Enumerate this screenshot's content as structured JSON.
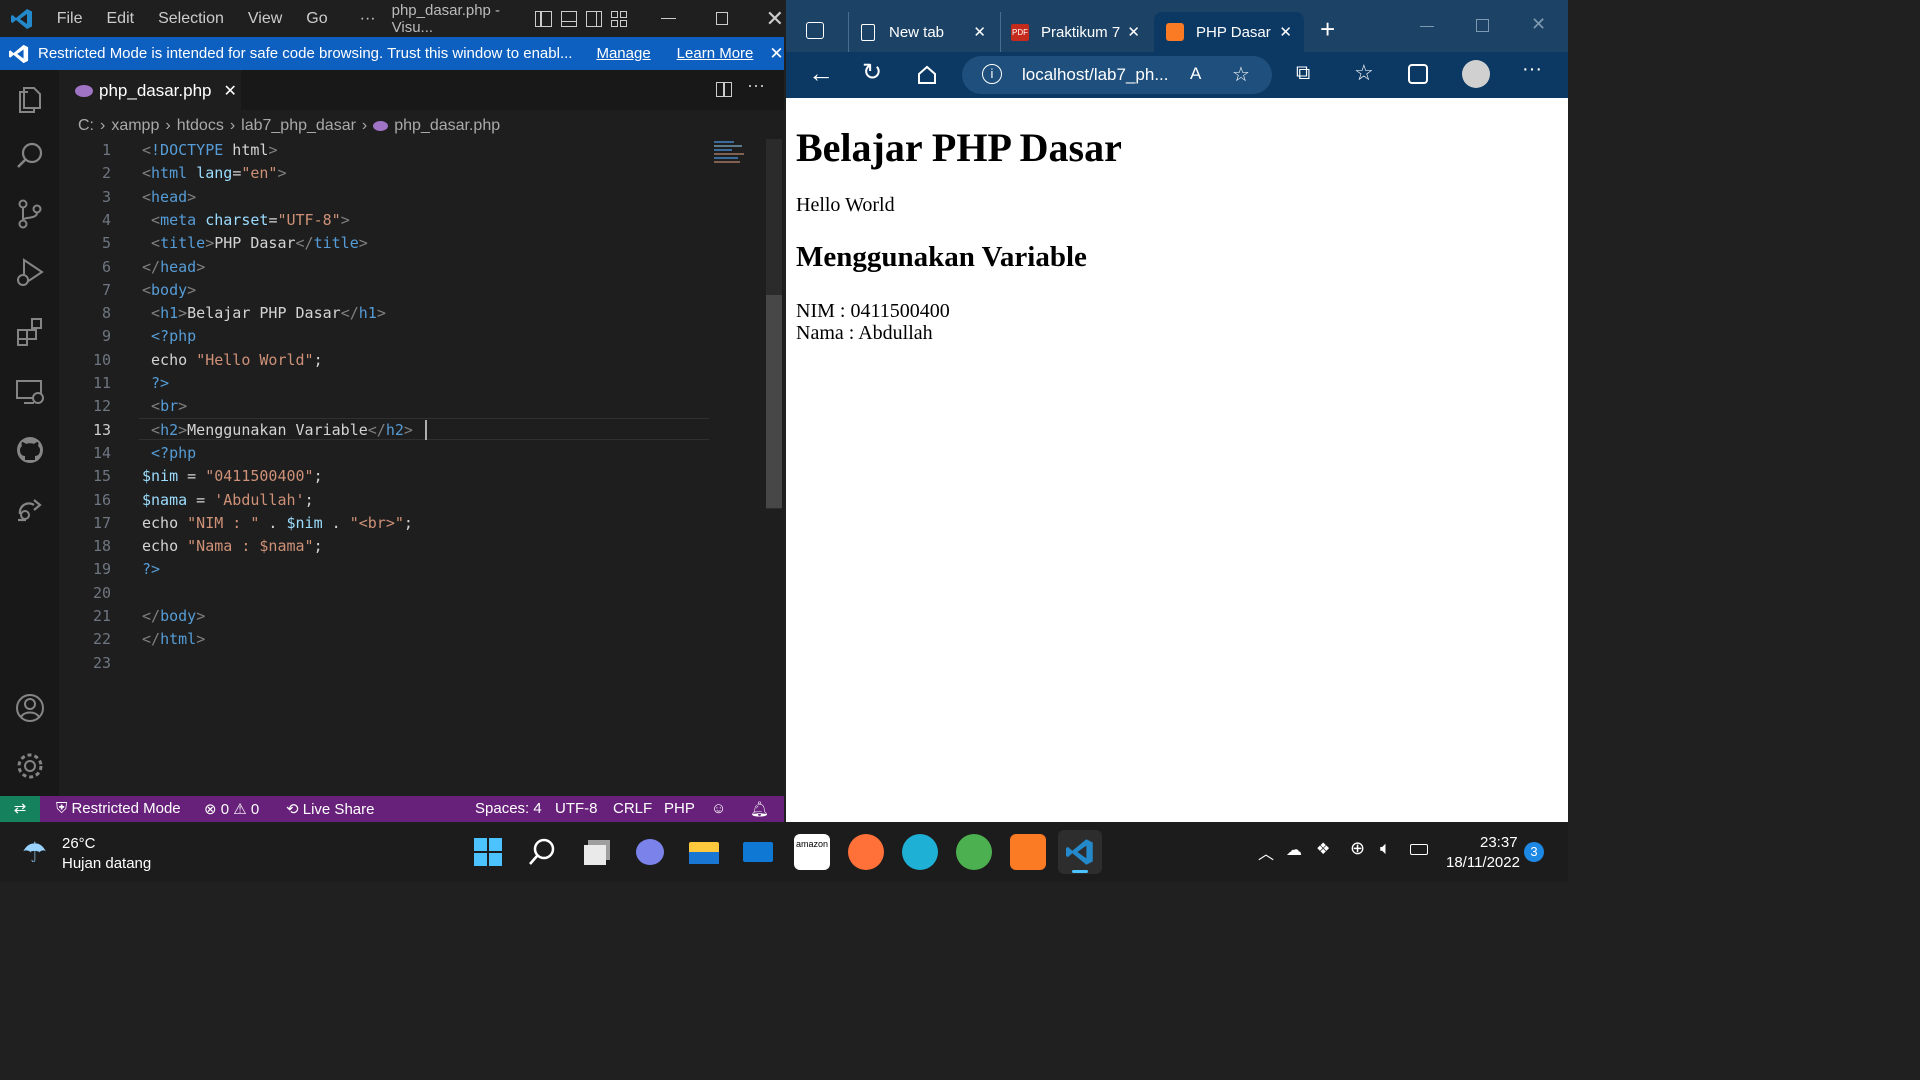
{
  "vscode": {
    "title": "php_dasar.php - Visu...",
    "menu": [
      "File",
      "Edit",
      "Selection",
      "View",
      "Go",
      "···"
    ],
    "banner": {
      "text": "Restricted Mode is intended for safe code browsing. Trust this window to enabl...",
      "manage": "Manage",
      "learn_more": "Learn More"
    },
    "tab": {
      "name": "php_dasar.php"
    },
    "breadcrumb": [
      "C:",
      "xampp",
      "htdocs",
      "lab7_php_dasar",
      "php_dasar.php"
    ],
    "line_numbers": [
      "1",
      "2",
      "3",
      "4",
      "5",
      "6",
      "7",
      "8",
      "9",
      "10",
      "11",
      "12",
      "13",
      "14",
      "15",
      "16",
      "17",
      "18",
      "19",
      "20",
      "21",
      "22",
      "23"
    ],
    "current_line": "13",
    "code": [
      "<!DOCTYPE html>",
      "<html lang=\"en\">",
      "<head>",
      " <meta charset=\"UTF-8\">",
      " <title>PHP Dasar</title>",
      "</head>",
      "<body>",
      " <h1>Belajar PHP Dasar</h1>",
      " <?php",
      " echo \"Hello World\";",
      " ?>",
      " <br>",
      " <h2>Menggunakan Variable</h2>",
      " <?php",
      "$nim = \"0411500400\";",
      "$nama = 'Abdullah';",
      "echo \"NIM : \" . $nim . \"<br>\";",
      "echo \"Nama : $nama\";",
      "?>",
      "",
      "</body>",
      "</html>",
      ""
    ],
    "status": {
      "mode": "Restricted Mode",
      "errors": "0",
      "warnings": "0",
      "live_share": "Live Share",
      "spaces": "Spaces: 4",
      "encoding": "UTF-8",
      "eol": "CRLF",
      "language": "PHP"
    }
  },
  "browser": {
    "tabs": [
      "New tab",
      "Praktikum 7",
      "PHP Dasar"
    ],
    "address": "localhost/lab7_ph...",
    "page": {
      "h1": "Belajar PHP Dasar",
      "hello": "Hello World",
      "h2": "Menggunakan Variable",
      "nim": "NIM : 0411500400",
      "nama": "Nama : Abdullah"
    }
  },
  "taskbar": {
    "temp": "26°C",
    "weather": "Hujan datang",
    "time": "23:37",
    "date": "18/11/2022",
    "notif_count": "3"
  },
  "colors": {
    "vscode_accent": "#0e60c0",
    "statusbar": "#68217a",
    "browser_chrome": "#0c3964"
  }
}
